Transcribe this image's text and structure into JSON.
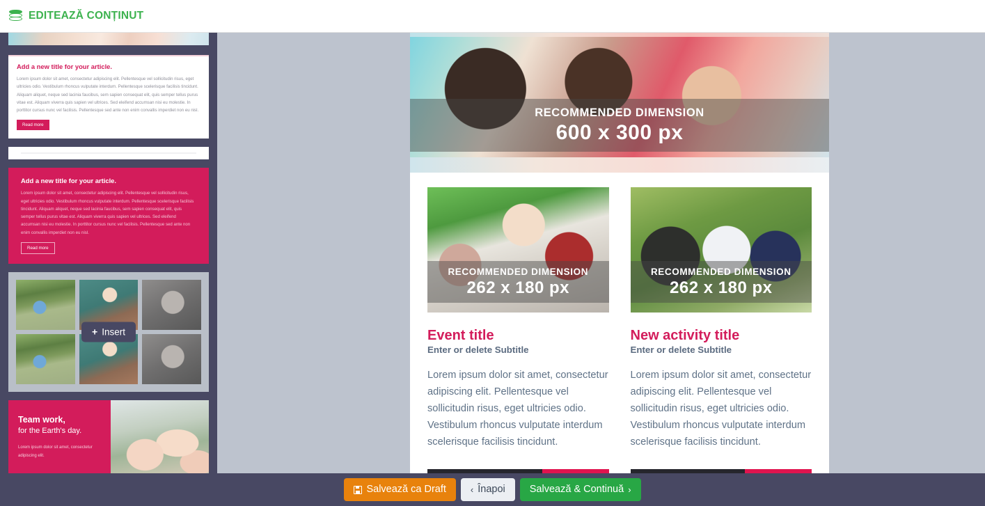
{
  "header": {
    "icon": "layers-icon",
    "title": "EDITEAZĂ CONȚINUT",
    "accent_color": "#3cb24e"
  },
  "colors": {
    "sidebar_bg": "#484863",
    "stage_bg": "#bdc3ce",
    "brand_pink": "#d31c5b",
    "green": "#28a745",
    "orange": "#e8820c"
  },
  "sidebar": {
    "blocks": [
      {
        "name": "photo-strip-block",
        "type": "photo"
      },
      {
        "name": "article-white-block",
        "type": "article",
        "title": "Add a new title for your article.",
        "body": "Lorem ipsum dolor sit amet, consectetur adipiscing elit. Pellentesque vel sollicitudin risus, eget ultricies odio. Vestibulum rhoncus vulputate interdum. Pellentesque scelerisque facilisis tincidunt. Aliquam aliquet, neque sed lacinia faucibus, sem sapien consequat elit, quis semper tellus purus vitae est. Aliquam viverra quis sapien vel ultrices. Sed eleifend accumsan nisi eu molestie. In porttitor cursus nunc vel facilisis. Pellentesque sed ante non enim convallis imperdiet non eu nisl.",
        "button_label": "Read more"
      },
      {
        "name": "divider-block",
        "type": "divider"
      },
      {
        "name": "article-pink-block",
        "type": "article",
        "title": "Add a new title for your article.",
        "body": "Lorem ipsum dolor sit amet, consectetur adipiscing elit. Pellentesque vel sollicitudin risus, eget ultricies odio. Vestibulum rhoncus vulputate interdum. Pellentesque scelerisque facilisis tincidunt. Aliquam aliquet, neque sed lacinia faucibus, sem sapien consequat elit, quis semper tellus purus vitae est. Aliquam viverra quis sapien vel ultrices. Sed eleifend accumsan nisi eu molestie. In porttitor cursus nunc vel facilisis. Pellentesque sed ante non enim convallis imperdiet non eu nisl.",
        "button_label": "Read more"
      },
      {
        "name": "image-gallery-block",
        "type": "gallery",
        "insert_label": "Insert",
        "insert_icon": "plus-icon",
        "thumbs": [
          "boy-on-bike",
          "teacher-at-blackboard",
          "boy-with-glasses",
          "boy-on-bike",
          "teacher-at-blackboard",
          "boy-with-glasses"
        ]
      },
      {
        "name": "teamwork-banner-block",
        "type": "banner",
        "heading": "Team work,",
        "subheading": "for the Earth's day.",
        "body": "Lorem ipsum dolor sit amet, consectetur adipiscing elit."
      }
    ]
  },
  "canvas": {
    "hero": {
      "name": "hero-image-placeholder",
      "dimension_label": "RECOMMENDED DIMENSION",
      "dimension_value": "600 x 300 px"
    },
    "cards": [
      {
        "name": "event-card",
        "image": {
          "alt": "teacher-with-children-tablet",
          "dimension_label": "RECOMMENDED DIMENSION",
          "dimension_value": "262 x 180 px"
        },
        "title": "Event title",
        "subtitle": "Enter or delete Subtitle",
        "text": "Lorem ipsum dolor sit amet, consectetur adipiscing elit. Pellentesque vel sollicitudin risus, eget ultricies odio. Vestibulum rhoncus vulputate interdum scelerisque facilisis tincidunt."
      },
      {
        "name": "activity-card",
        "image": {
          "alt": "back-to-school-children",
          "dimension_label": "RECOMMENDED DIMENSION",
          "dimension_value": "262 x 180 px"
        },
        "title": "New activity title",
        "subtitle": "Enter or delete Subtitle",
        "text": "Lorem ipsum dolor sit amet, consectetur adipiscing elit. Pellentesque vel sollicitudin risus, eget ultricies odio. Vestibulum rhoncus vulputate interdum scelerisque facilisis tincidunt."
      }
    ]
  },
  "actionbar": {
    "save_draft_label": "Salvează ca Draft",
    "save_draft_icon": "save-icon",
    "back_label": "Înapoi",
    "back_icon": "chevron-left-icon",
    "continue_label": "Salvează & Continuă",
    "continue_icon": "chevron-right-icon"
  }
}
